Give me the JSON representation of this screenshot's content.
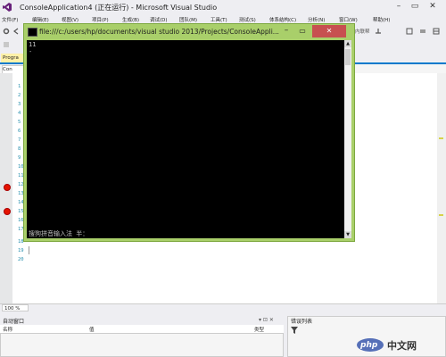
{
  "vs": {
    "title": "ConsoleApplication4 (正在运行) - Microsoft Visual Studio",
    "menu": [
      "文件(F)",
      "编辑(E)",
      "视图(V)",
      "项目(P)",
      "生成(B)",
      "调试(D)",
      "团队(M)",
      "工具(T)",
      "测试(S)",
      "体系结构(C)",
      "分析(N)",
      "窗口(W)",
      "帮助(H)"
    ],
    "toolbar_label": "内联帮",
    "editor_tab": "Progra",
    "nav_combo": "Con",
    "line_numbers": [
      "1",
      "2",
      "3",
      "4",
      "5",
      "6",
      "7",
      "8",
      "9",
      "10",
      "11",
      "12",
      "13",
      "14",
      "15",
      "16",
      "17",
      "18",
      "19",
      "20"
    ],
    "zoom": "100 %",
    "bottom_left": {
      "title": "自动窗口",
      "col_name": "名称",
      "col_value": "值",
      "col_type": "类型"
    },
    "bottom_right": {
      "title": "错误列表"
    }
  },
  "console": {
    "title": "file:///c:/users/hp/documents/visual studio 2013/Projects/ConsoleAppli...",
    "output_line1": "11",
    "output_line2": "-",
    "prompt": "搜狗拼音输入法 半："
  },
  "watermark": {
    "logo": "php",
    "text": "中文网"
  },
  "colors": {
    "console_frame": "#a9cf6a",
    "accent": "#007acc",
    "breakpoint": "#e51400"
  }
}
